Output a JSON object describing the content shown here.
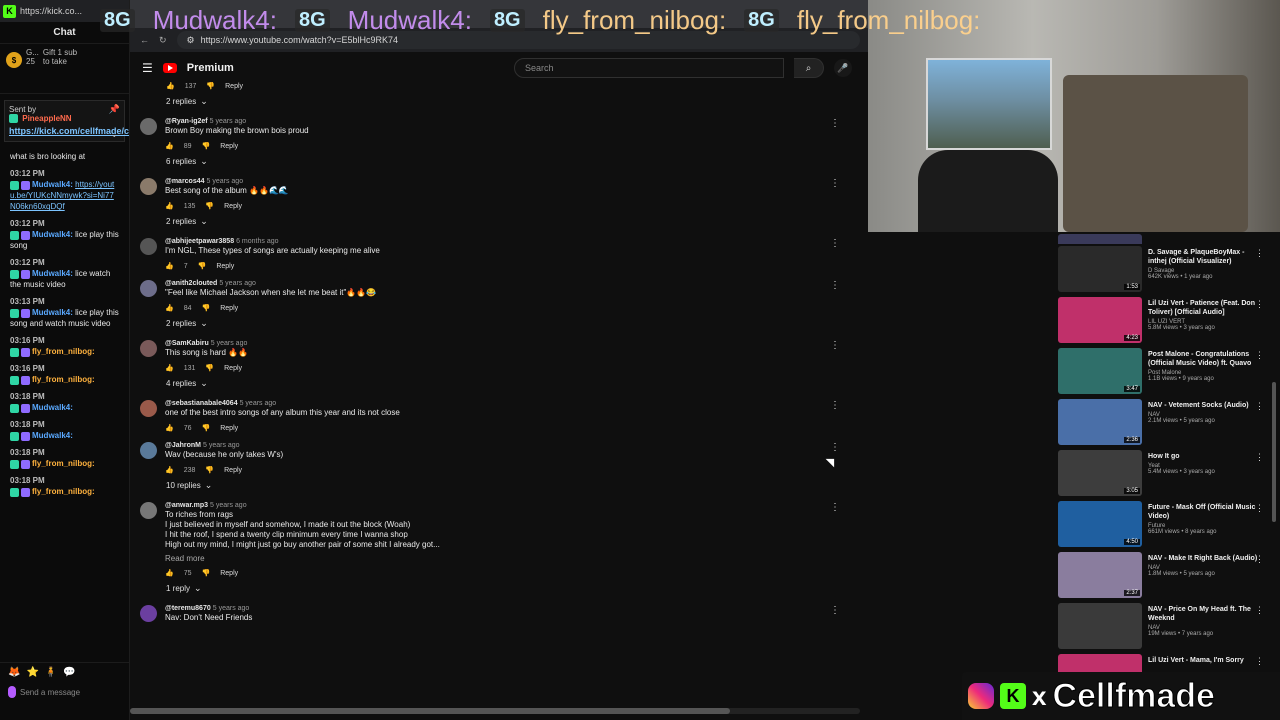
{
  "banner": {
    "items": [
      "Mudwalk4:",
      "Mudwalk4:",
      "fly_from_nilbog:",
      "fly_from_nilbog:"
    ],
    "badge": "8G"
  },
  "kick_tab": {
    "url": "https://kick.co..."
  },
  "chat": {
    "title": "Chat",
    "gift": {
      "user": "G...",
      "count": "25",
      "text": "Gift 1 sub to take"
    },
    "pinned": {
      "sent_by": "Sent by",
      "user": "PineappleNN",
      "link": "https://kick.com/cellfmade/clips/cl..."
    },
    "messages": [
      {
        "time": "",
        "user": "",
        "text": "what is bro looking at",
        "link": ""
      },
      {
        "time": "03:12 PM",
        "user": "Mudwalk4:",
        "text": "",
        "link": "https://youtu.be/YIUKcNNmywk?si=Ni77N06kn60xqDQf"
      },
      {
        "time": "03:12 PM",
        "user": "Mudwalk4:",
        "text": "lice play this song",
        "link": ""
      },
      {
        "time": "03:12 PM",
        "user": "Mudwalk4:",
        "text": "lice watch the music video",
        "link": ""
      },
      {
        "time": "03:13 PM",
        "user": "Mudwalk4:",
        "text": "lice play this song and watch music video",
        "link": ""
      },
      {
        "time": "03:16 PM",
        "user": "fly_from_nilbog:",
        "text": "",
        "link": ""
      },
      {
        "time": "03:16 PM",
        "user": "fly_from_nilbog:",
        "text": "",
        "link": ""
      },
      {
        "time": "03:18 PM",
        "user": "Mudwalk4:",
        "text": "",
        "link": ""
      },
      {
        "time": "03:18 PM",
        "user": "Mudwalk4:",
        "text": "",
        "link": ""
      },
      {
        "time": "03:18 PM",
        "user": "fly_from_nilbog:",
        "text": "",
        "link": ""
      },
      {
        "time": "03:18 PM",
        "user": "fly_from_nilbog:",
        "text": "",
        "link": ""
      }
    ],
    "send_placeholder": "Send a message"
  },
  "browser": {
    "url": "https://www.youtube.com/watch?v=E5blHc9RK74",
    "yt_title": "Premium",
    "search_placeholder": "Search"
  },
  "comments": {
    "top": {
      "likes": "137",
      "reply": "Reply",
      "replies": "2 replies"
    },
    "items": [
      {
        "author": "@Ryan-ig2ef",
        "age": "5 years ago",
        "text": "Brown Boy making the brown bois proud",
        "likes": "89",
        "replies": "6 replies"
      },
      {
        "author": "@marcos44",
        "age": "5 years ago",
        "text": "Best song of the album 🔥🔥🌊🌊",
        "likes": "135",
        "replies": "2 replies"
      },
      {
        "author": "@abhijeetpawar3858",
        "age": "6 months ago",
        "text": "I'm NGL, These types of songs are actually keeping me alive",
        "likes": "7",
        "replies": ""
      },
      {
        "author": "@anith2clouted",
        "age": "5 years ago",
        "text": "\"Feel like Michael Jackson when she let me beat it\"🔥🔥😂",
        "likes": "84",
        "replies": "2 replies"
      },
      {
        "author": "@SamKabiru",
        "age": "5 years ago",
        "text": "This song is hard 🔥🔥",
        "likes": "131",
        "replies": "4 replies"
      },
      {
        "author": "@sebastianabale4064",
        "age": "5 years ago",
        "text": "one of the best intro songs of any album this year and its not close",
        "likes": "76",
        "replies": ""
      },
      {
        "author": "@JahronM",
        "age": "5 years ago",
        "text": "Wav (because he only takes W's)",
        "likes": "238",
        "replies": "10 replies"
      },
      {
        "author": "@anwar.mp3",
        "age": "5 years ago",
        "text": "To riches from rags\nI just believed in myself and somehow, I made it out the block (Woah)\nI hit the roof, I spend a twenty clip minimum every time I wanna shop\nHigh out my mind, I might just go buy another pair of some shit I already got...",
        "likes": "75",
        "replies": "1 reply",
        "read_more": "Read more"
      },
      {
        "author": "@teremu8670",
        "age": "5 years ago",
        "text": "Nav: Don't Need Friends",
        "likes": "",
        "replies": ""
      }
    ],
    "reply_label": "Reply"
  },
  "sidebar": {
    "videos": [
      {
        "title": "",
        "channel": "",
        "meta": "",
        "duration": "2:13",
        "color": "#3a3a5a"
      },
      {
        "title": "D. Savage & PlaqueBoyMax - inthej (Official Visualizer)",
        "channel": "D Savage",
        "meta": "642K views • 1 year ago",
        "duration": "1:53",
        "color": "#2a2a2a"
      },
      {
        "title": "Lil Uzi Vert - Patience (Feat. Don Toliver) [Official Audio]",
        "channel": "LIL UZI VERT",
        "meta": "5.8M views • 3 years ago",
        "duration": "4:23",
        "color": "#c0306a"
      },
      {
        "title": "Post Malone - Congratulations (Official Music Video) ft. Quavo",
        "channel": "Post Malone",
        "meta": "1.1B views • 9 years ago",
        "duration": "3:47",
        "color": "#2f6f6a"
      },
      {
        "title": "NAV - Vetement Socks (Audio)",
        "channel": "NAV",
        "meta": "2.1M views • 5 years ago",
        "duration": "2:36",
        "color": "#4a6fa8"
      },
      {
        "title": "How It go",
        "channel": "Yeat",
        "meta": "5.4M views • 3 years ago",
        "duration": "3:05",
        "color": "#3d3d3d"
      },
      {
        "title": "Future - Mask Off (Official Music Video)",
        "channel": "Future",
        "meta": "661M views • 8 years ago",
        "duration": "4:50",
        "color": "#1f5fa0"
      },
      {
        "title": "NAV - Make It Right Back (Audio)",
        "channel": "NAV",
        "meta": "1.8M views • 5 years ago",
        "duration": "2:37",
        "color": "#8a7d9e"
      },
      {
        "title": "NAV - Price On My Head ft. The Weeknd",
        "channel": "NAV",
        "meta": "19M views • 7 years ago",
        "duration": "",
        "color": "#3a3a3a"
      },
      {
        "title": "Lil Uzi Vert - Mama, I'm Sorry",
        "channel": "",
        "meta": "",
        "duration": "",
        "color": "#c0306a"
      }
    ]
  },
  "brand": {
    "text": "Cellfmade",
    "x": "x"
  },
  "colors": {
    "accent_red": "#ff0000",
    "kick_green": "#53fc18",
    "link_blue": "#7cc4ff"
  }
}
